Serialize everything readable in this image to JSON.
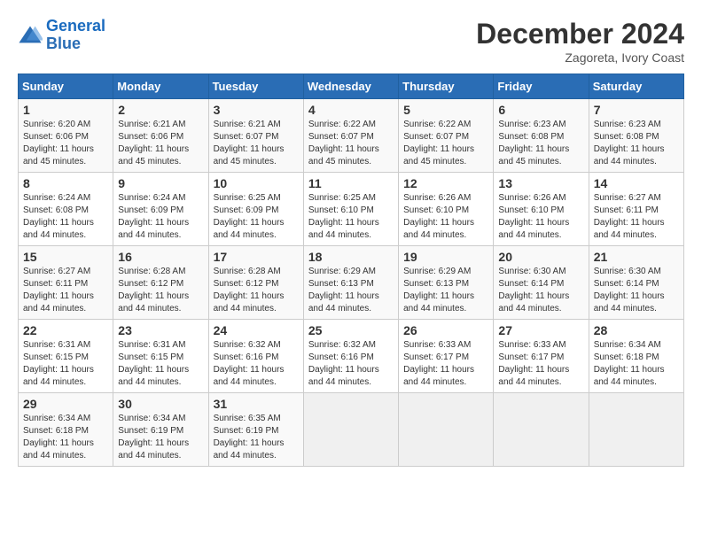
{
  "header": {
    "logo_general": "General",
    "logo_blue": "Blue",
    "month_title": "December 2024",
    "location": "Zagoreta, Ivory Coast"
  },
  "days_of_week": [
    "Sunday",
    "Monday",
    "Tuesday",
    "Wednesday",
    "Thursday",
    "Friday",
    "Saturday"
  ],
  "weeks": [
    [
      {
        "day": "1",
        "sunrise": "6:20 AM",
        "sunset": "6:06 PM",
        "daylight": "11 hours and 45 minutes."
      },
      {
        "day": "2",
        "sunrise": "6:21 AM",
        "sunset": "6:06 PM",
        "daylight": "11 hours and 45 minutes."
      },
      {
        "day": "3",
        "sunrise": "6:21 AM",
        "sunset": "6:07 PM",
        "daylight": "11 hours and 45 minutes."
      },
      {
        "day": "4",
        "sunrise": "6:22 AM",
        "sunset": "6:07 PM",
        "daylight": "11 hours and 45 minutes."
      },
      {
        "day": "5",
        "sunrise": "6:22 AM",
        "sunset": "6:07 PM",
        "daylight": "11 hours and 45 minutes."
      },
      {
        "day": "6",
        "sunrise": "6:23 AM",
        "sunset": "6:08 PM",
        "daylight": "11 hours and 45 minutes."
      },
      {
        "day": "7",
        "sunrise": "6:23 AM",
        "sunset": "6:08 PM",
        "daylight": "11 hours and 44 minutes."
      }
    ],
    [
      {
        "day": "8",
        "sunrise": "6:24 AM",
        "sunset": "6:08 PM",
        "daylight": "11 hours and 44 minutes."
      },
      {
        "day": "9",
        "sunrise": "6:24 AM",
        "sunset": "6:09 PM",
        "daylight": "11 hours and 44 minutes."
      },
      {
        "day": "10",
        "sunrise": "6:25 AM",
        "sunset": "6:09 PM",
        "daylight": "11 hours and 44 minutes."
      },
      {
        "day": "11",
        "sunrise": "6:25 AM",
        "sunset": "6:10 PM",
        "daylight": "11 hours and 44 minutes."
      },
      {
        "day": "12",
        "sunrise": "6:26 AM",
        "sunset": "6:10 PM",
        "daylight": "11 hours and 44 minutes."
      },
      {
        "day": "13",
        "sunrise": "6:26 AM",
        "sunset": "6:10 PM",
        "daylight": "11 hours and 44 minutes."
      },
      {
        "day": "14",
        "sunrise": "6:27 AM",
        "sunset": "6:11 PM",
        "daylight": "11 hours and 44 minutes."
      }
    ],
    [
      {
        "day": "15",
        "sunrise": "6:27 AM",
        "sunset": "6:11 PM",
        "daylight": "11 hours and 44 minutes."
      },
      {
        "day": "16",
        "sunrise": "6:28 AM",
        "sunset": "6:12 PM",
        "daylight": "11 hours and 44 minutes."
      },
      {
        "day": "17",
        "sunrise": "6:28 AM",
        "sunset": "6:12 PM",
        "daylight": "11 hours and 44 minutes."
      },
      {
        "day": "18",
        "sunrise": "6:29 AM",
        "sunset": "6:13 PM",
        "daylight": "11 hours and 44 minutes."
      },
      {
        "day": "19",
        "sunrise": "6:29 AM",
        "sunset": "6:13 PM",
        "daylight": "11 hours and 44 minutes."
      },
      {
        "day": "20",
        "sunrise": "6:30 AM",
        "sunset": "6:14 PM",
        "daylight": "11 hours and 44 minutes."
      },
      {
        "day": "21",
        "sunrise": "6:30 AM",
        "sunset": "6:14 PM",
        "daylight": "11 hours and 44 minutes."
      }
    ],
    [
      {
        "day": "22",
        "sunrise": "6:31 AM",
        "sunset": "6:15 PM",
        "daylight": "11 hours and 44 minutes."
      },
      {
        "day": "23",
        "sunrise": "6:31 AM",
        "sunset": "6:15 PM",
        "daylight": "11 hours and 44 minutes."
      },
      {
        "day": "24",
        "sunrise": "6:32 AM",
        "sunset": "6:16 PM",
        "daylight": "11 hours and 44 minutes."
      },
      {
        "day": "25",
        "sunrise": "6:32 AM",
        "sunset": "6:16 PM",
        "daylight": "11 hours and 44 minutes."
      },
      {
        "day": "26",
        "sunrise": "6:33 AM",
        "sunset": "6:17 PM",
        "daylight": "11 hours and 44 minutes."
      },
      {
        "day": "27",
        "sunrise": "6:33 AM",
        "sunset": "6:17 PM",
        "daylight": "11 hours and 44 minutes."
      },
      {
        "day": "28",
        "sunrise": "6:34 AM",
        "sunset": "6:18 PM",
        "daylight": "11 hours and 44 minutes."
      }
    ],
    [
      {
        "day": "29",
        "sunrise": "6:34 AM",
        "sunset": "6:18 PM",
        "daylight": "11 hours and 44 minutes."
      },
      {
        "day": "30",
        "sunrise": "6:34 AM",
        "sunset": "6:19 PM",
        "daylight": "11 hours and 44 minutes."
      },
      {
        "day": "31",
        "sunrise": "6:35 AM",
        "sunset": "6:19 PM",
        "daylight": "11 hours and 44 minutes."
      },
      null,
      null,
      null,
      null
    ]
  ]
}
